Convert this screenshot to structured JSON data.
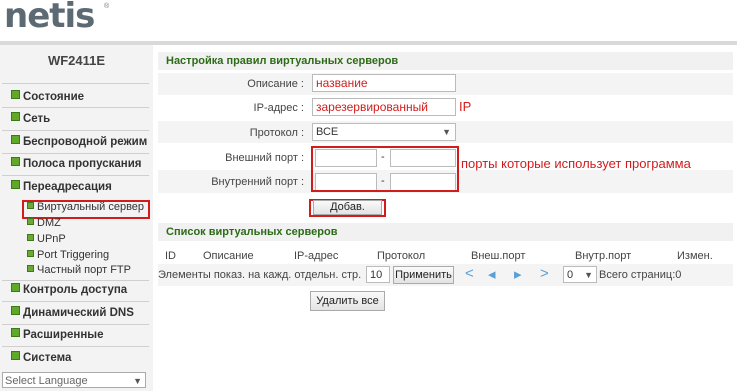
{
  "brand": {
    "logo": "netis",
    "reg": "®"
  },
  "sidebar": {
    "model": "WF2411E",
    "menu": [
      {
        "label": "Состояние"
      },
      {
        "label": "Сеть"
      },
      {
        "label": "Беспроводной режим"
      },
      {
        "label": "Полоса пропускания"
      },
      {
        "label": "Переадресация"
      },
      {
        "label": "Контроль доступа"
      },
      {
        "label": "Динамический DNS"
      },
      {
        "label": "Расширенные"
      },
      {
        "label": "Система"
      }
    ],
    "submenu": [
      {
        "label": "Виртуальный сервер"
      },
      {
        "label": "DMZ"
      },
      {
        "label": "UPnP"
      },
      {
        "label": "Port Triggering"
      },
      {
        "label": "Частный порт FTP"
      }
    ],
    "language": {
      "value": "Select Language"
    }
  },
  "form": {
    "title": "Настройка правил виртуальных серверов",
    "description_label": "Описание :",
    "description_value": "название",
    "ip_label": "IP-адрес :",
    "ip_value": "зарезервированный",
    "ip_suffix": "IP",
    "protocol_label": "Протокол :",
    "protocol_value": "ВСЕ",
    "ext_port_label": "Внешний порт :",
    "int_port_label": "Внутренний порт :",
    "dash": "-",
    "ports_hint": "порты которые использует программа",
    "add_button": "Добав."
  },
  "list": {
    "title": "Список виртуальных серверов",
    "columns": [
      "ID",
      "Описание",
      "IP-адрес",
      "Протокол",
      "Внеш.порт",
      "Внутр.порт",
      "Измен."
    ],
    "per_page_label": "Элементы показ. на кажд. отдельн. стр.",
    "per_page_value": "10",
    "apply_button": "Применить",
    "page_select": "0",
    "total_pages": "Всего страниц:0",
    "delete_all_button": "Удалить все"
  },
  "colors": {
    "accent_green": "#2d6b18",
    "annotation_red": "#d21c1c"
  }
}
